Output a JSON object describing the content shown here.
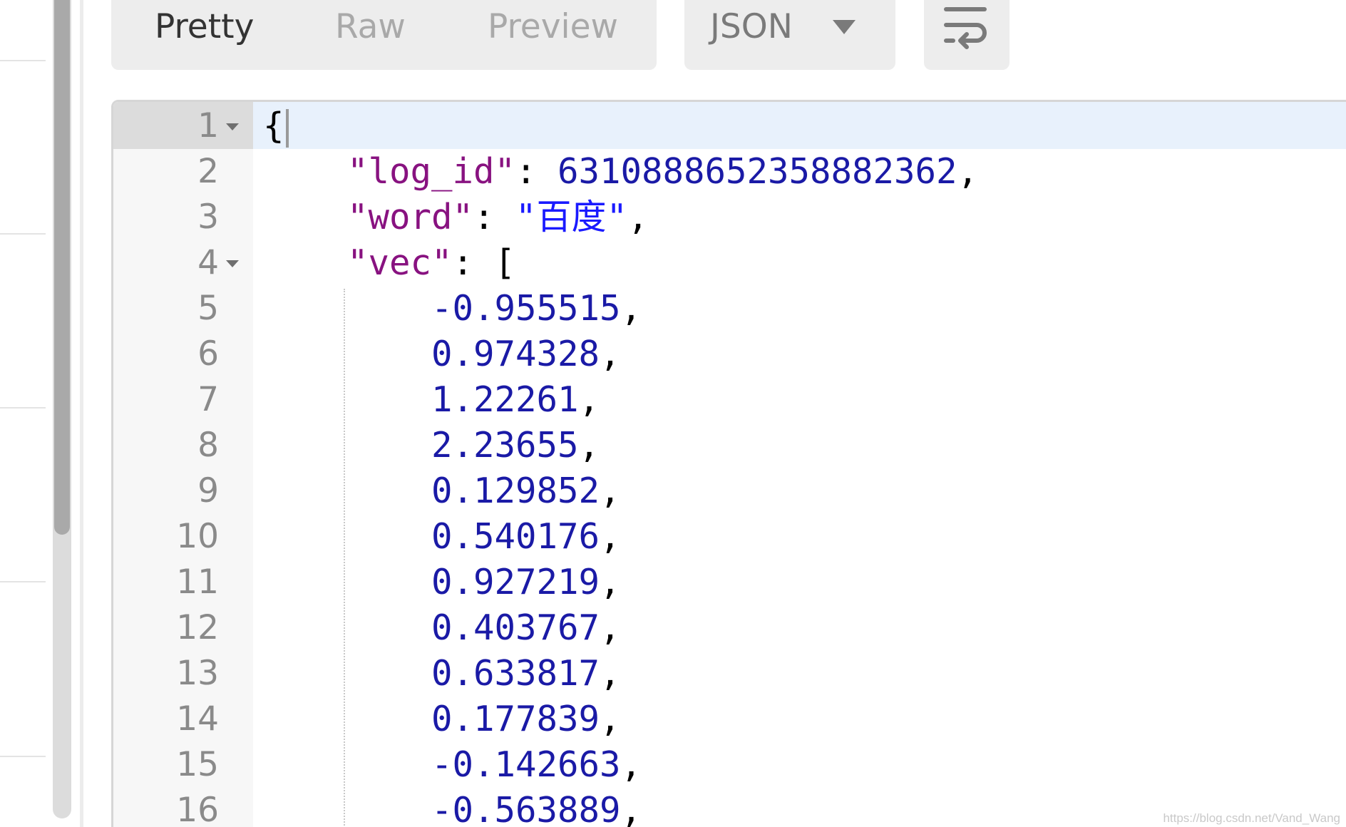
{
  "toolbar": {
    "view_tabs": [
      "Pretty",
      "Raw",
      "Preview"
    ],
    "active_view": "Pretty",
    "format": "JSON",
    "wrap_icon": "wrap-lines-icon"
  },
  "editor": {
    "lines": [
      {
        "n": "1",
        "fold": true,
        "tokens": [
          {
            "t": "punc",
            "v": "{"
          }
        ]
      },
      {
        "n": "2",
        "fold": false,
        "tokens": [
          {
            "t": "ws",
            "v": "    "
          },
          {
            "t": "key",
            "v": "\"log_id\""
          },
          {
            "t": "punc",
            "v": ": "
          },
          {
            "t": "num",
            "v": "6310888652358882362"
          },
          {
            "t": "punc",
            "v": ","
          }
        ]
      },
      {
        "n": "3",
        "fold": false,
        "tokens": [
          {
            "t": "ws",
            "v": "    "
          },
          {
            "t": "key",
            "v": "\"word\""
          },
          {
            "t": "punc",
            "v": ": "
          },
          {
            "t": "str",
            "v": "\"百度\""
          },
          {
            "t": "punc",
            "v": ","
          }
        ]
      },
      {
        "n": "4",
        "fold": true,
        "tokens": [
          {
            "t": "ws",
            "v": "    "
          },
          {
            "t": "key",
            "v": "\"vec\""
          },
          {
            "t": "punc",
            "v": ": ["
          }
        ]
      },
      {
        "n": "5",
        "fold": false,
        "tokens": [
          {
            "t": "ws",
            "v": "        "
          },
          {
            "t": "num",
            "v": "-0.955515"
          },
          {
            "t": "punc",
            "v": ","
          }
        ]
      },
      {
        "n": "6",
        "fold": false,
        "tokens": [
          {
            "t": "ws",
            "v": "        "
          },
          {
            "t": "num",
            "v": "0.974328"
          },
          {
            "t": "punc",
            "v": ","
          }
        ]
      },
      {
        "n": "7",
        "fold": false,
        "tokens": [
          {
            "t": "ws",
            "v": "        "
          },
          {
            "t": "num",
            "v": "1.22261"
          },
          {
            "t": "punc",
            "v": ","
          }
        ]
      },
      {
        "n": "8",
        "fold": false,
        "tokens": [
          {
            "t": "ws",
            "v": "        "
          },
          {
            "t": "num",
            "v": "2.23655"
          },
          {
            "t": "punc",
            "v": ","
          }
        ]
      },
      {
        "n": "9",
        "fold": false,
        "tokens": [
          {
            "t": "ws",
            "v": "        "
          },
          {
            "t": "num",
            "v": "0.129852"
          },
          {
            "t": "punc",
            "v": ","
          }
        ]
      },
      {
        "n": "10",
        "fold": false,
        "tokens": [
          {
            "t": "ws",
            "v": "        "
          },
          {
            "t": "num",
            "v": "0.540176"
          },
          {
            "t": "punc",
            "v": ","
          }
        ]
      },
      {
        "n": "11",
        "fold": false,
        "tokens": [
          {
            "t": "ws",
            "v": "        "
          },
          {
            "t": "num",
            "v": "0.927219"
          },
          {
            "t": "punc",
            "v": ","
          }
        ]
      },
      {
        "n": "12",
        "fold": false,
        "tokens": [
          {
            "t": "ws",
            "v": "        "
          },
          {
            "t": "num",
            "v": "0.403767"
          },
          {
            "t": "punc",
            "v": ","
          }
        ]
      },
      {
        "n": "13",
        "fold": false,
        "tokens": [
          {
            "t": "ws",
            "v": "        "
          },
          {
            "t": "num",
            "v": "0.633817"
          },
          {
            "t": "punc",
            "v": ","
          }
        ]
      },
      {
        "n": "14",
        "fold": false,
        "tokens": [
          {
            "t": "ws",
            "v": "        "
          },
          {
            "t": "num",
            "v": "0.177839"
          },
          {
            "t": "punc",
            "v": ","
          }
        ]
      },
      {
        "n": "15",
        "fold": false,
        "tokens": [
          {
            "t": "ws",
            "v": "        "
          },
          {
            "t": "num",
            "v": "-0.142663"
          },
          {
            "t": "punc",
            "v": ","
          }
        ]
      },
      {
        "n": "16",
        "fold": false,
        "tokens": [
          {
            "t": "ws",
            "v": "        "
          },
          {
            "t": "num",
            "v": "-0.563889"
          },
          {
            "t": "punc",
            "v": ","
          }
        ]
      }
    ]
  },
  "watermark": "https://blog.csdn.net/Vand_Wang"
}
